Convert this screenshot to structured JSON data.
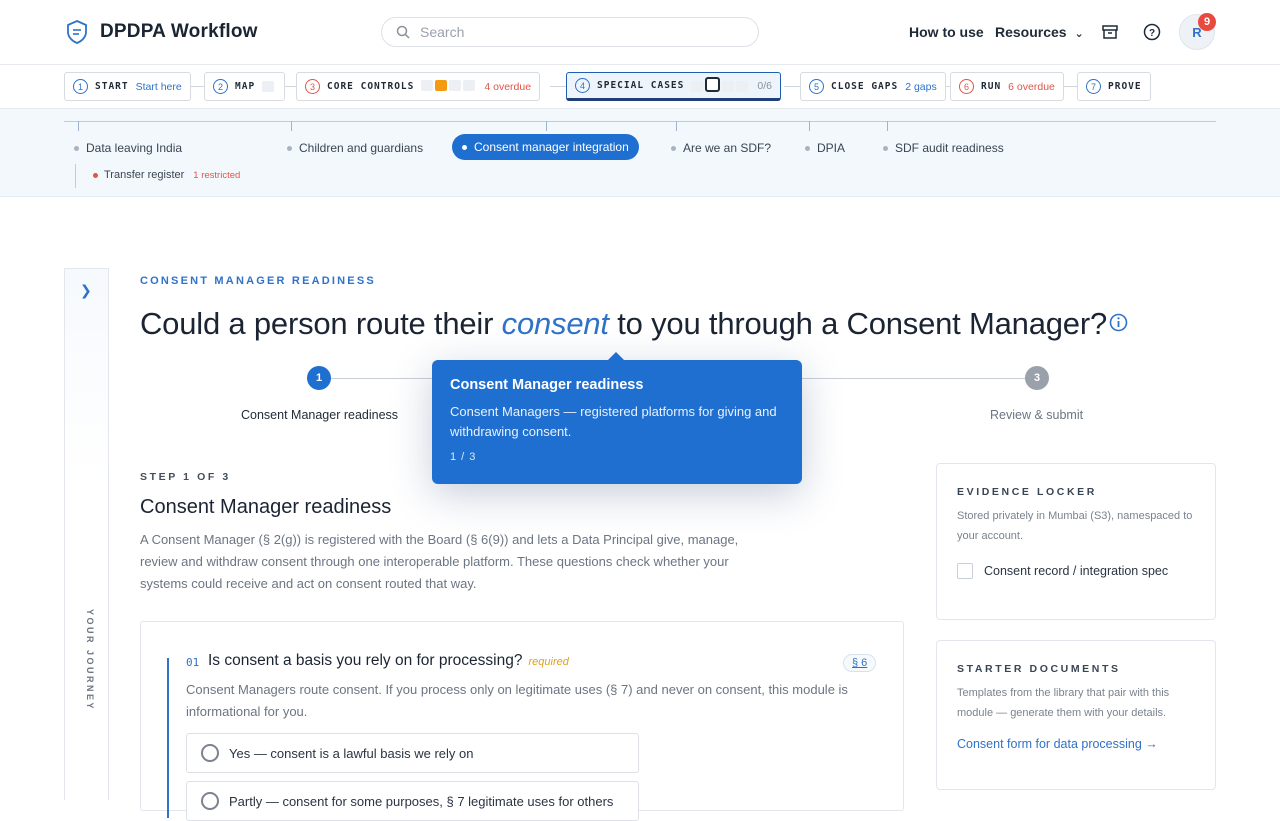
{
  "app": {
    "title": "DPDPA Workflow"
  },
  "search": {
    "placeholder": "Search"
  },
  "header": {
    "how_to_use": "How to use",
    "resources": "Resources",
    "avatar_initial": "R",
    "notification_count": "9"
  },
  "steps": [
    {
      "num": "1",
      "label": "START",
      "sub": "Start here"
    },
    {
      "num": "2",
      "label": "MAP",
      "sub": ""
    },
    {
      "num": "3",
      "label": "CORE CONTROLS",
      "sub": "4 overdue"
    },
    {
      "num": "4",
      "label": "SPECIAL CASES",
      "sub": "0/6"
    },
    {
      "num": "5",
      "label": "CLOSE GAPS",
      "sub": "2 gaps"
    },
    {
      "num": "6",
      "label": "RUN",
      "sub": "6 overdue"
    },
    {
      "num": "7",
      "label": "PROVE",
      "sub": ""
    }
  ],
  "subnav": {
    "items": [
      "Data leaving India",
      "Children and guardians",
      "Consent manager integration",
      "Are we an SDF?",
      "DPIA",
      "SDF audit readiness"
    ],
    "transfer_register": "Transfer register",
    "transfer_tag": "1 restricted"
  },
  "journey": {
    "label": "YOUR JOURNEY"
  },
  "page": {
    "eyebrow": "CONSENT MANAGER READINESS",
    "headline_pre": "Could a person route their ",
    "headline_em": "consent",
    "headline_post": " to you through a Consent Manager?"
  },
  "progress": {
    "steps": [
      {
        "num": "1",
        "label": "Consent Manager readiness"
      },
      {
        "num": "3",
        "label": "Review & submit"
      }
    ]
  },
  "tooltip": {
    "title": "Consent Manager readiness",
    "body": "Consent Managers — registered platforms for giving and withdrawing consent.",
    "count": "1 / 3"
  },
  "section": {
    "eyebrow": "STEP 1 OF 3",
    "title": "Consent Manager readiness",
    "desc": "A Consent Manager (§ 2(g)) is registered with the Board (§ 6(9)) and lets a Data Principal give, manage, review and withdraw consent through one interoperable platform. These questions check whether your systems could receive and act on consent routed that way."
  },
  "question": {
    "num": "01",
    "title": "Is consent a basis you rely on for processing?",
    "required": "required",
    "ref": "§ 6",
    "desc": "Consent Managers route consent. If you process only on legitimate uses (§ 7) and never on consent, this module is informational for you.",
    "options": [
      "Yes — consent is a lawful basis we rely on",
      "Partly — consent for some purposes, § 7 legitimate uses for others"
    ]
  },
  "evidence": {
    "eyebrow": "EVIDENCE LOCKER",
    "desc": "Stored privately in Mumbai (S3), namespaced to your account.",
    "item": "Consent record / integration spec"
  },
  "starter": {
    "eyebrow": "STARTER DOCUMENTS",
    "desc": "Templates from the library that pair with this module — generate them with your details.",
    "link": "Consent form for data processing →"
  },
  "colors": {
    "accent": "#2f72c8",
    "active_pill": "#1f6fd1",
    "danger": "#e0554a",
    "warning": "#f39c12"
  }
}
